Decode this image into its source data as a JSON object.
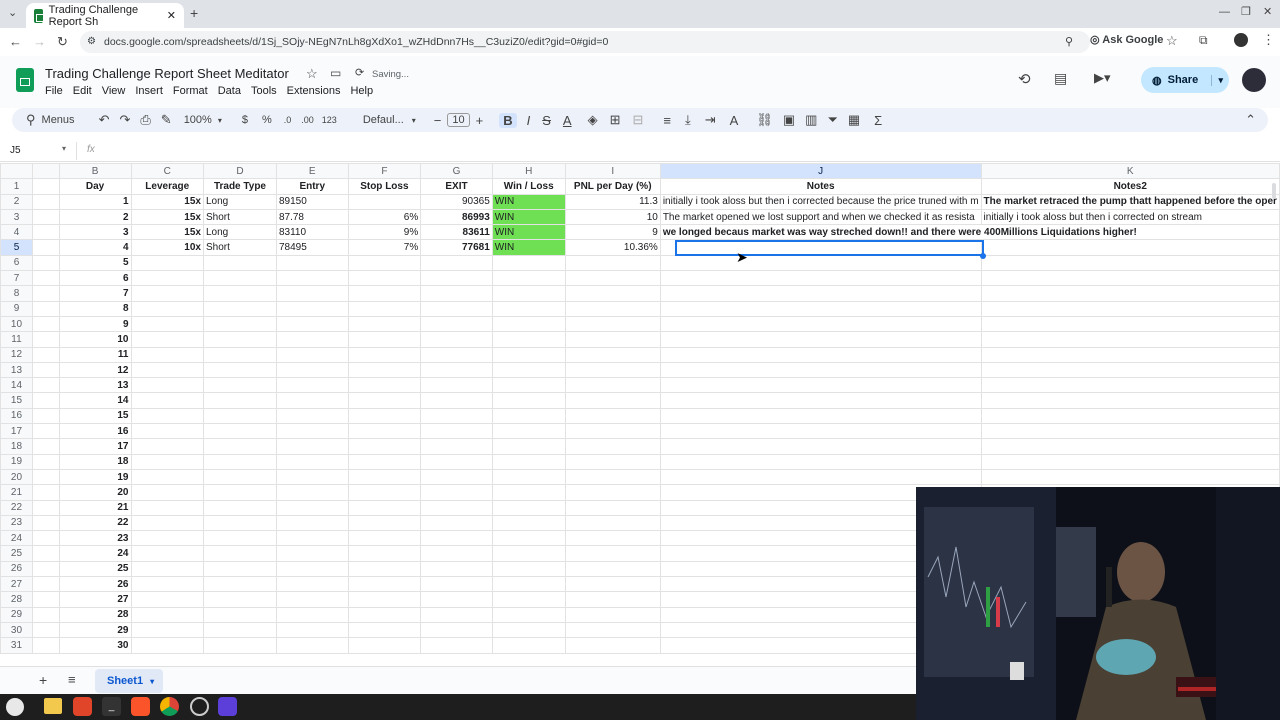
{
  "browser": {
    "tab_title": "Trading Challenge Report Sh",
    "new_tab": "+",
    "url": "docs.google.com/spreadsheets/d/1Sj_SOjy-NEgN7nLh8gXdXo1_wZHdDnn7Hs__C3uziZ0/edit?gid=0#gid=0",
    "ask_google": "Ask Google"
  },
  "doc": {
    "title": "Trading Challenge Report Sheet Meditator",
    "status": "Saving...",
    "menus": [
      "File",
      "Edit",
      "View",
      "Insert",
      "Format",
      "Data",
      "Tools",
      "Extensions",
      "Help"
    ],
    "share": "Share"
  },
  "toolbar": {
    "menus_label": "Menus",
    "zoom": "100%",
    "currency": "$",
    "percent": "%",
    "dec_dec": ".0",
    "dec_inc": ".00",
    "number_format": "123",
    "font": "Defaul...",
    "font_size": "10"
  },
  "formula": {
    "cell_ref": "J5",
    "fx": "fx"
  },
  "columns": [
    "B",
    "C",
    "D",
    "E",
    "F",
    "G",
    "H",
    "I",
    "J",
    "K"
  ],
  "headers": [
    "Day",
    "Leverage",
    "Trade Type",
    "Entry",
    "Stop Loss",
    "EXIT",
    "Win / Loss",
    "PNL per Day (%)",
    "Notes",
    "Notes2"
  ],
  "rows": [
    {
      "n": "2",
      "day": "1",
      "lev": "15x",
      "type": "Long",
      "entry": "89150",
      "sl": "",
      "exit": "90365",
      "wl": "WIN",
      "pnl": "11.3",
      "notes": "initially i took aloss but then i corrected because the price truned with m",
      "notes2": "The market retraced the pump thatt happened before the oper"
    },
    {
      "n": "3",
      "day": "2",
      "lev": "15x",
      "type": "Short",
      "entry": "87.78",
      "sl": "6%",
      "exit": "86993",
      "wl": "WIN",
      "pnl": "10",
      "notes": "The market opened we lost support and when we checked it as resista",
      "notes2": "initially i took aloss but then i corrected on stream"
    },
    {
      "n": "4",
      "day": "3",
      "lev": "15x",
      "type": "Long",
      "entry": "83110",
      "sl": "9%",
      "exit": "83611",
      "wl": "WIN",
      "pnl": "9",
      "notes": "we longed becaus market was way streched down!! and there were 400Millions Liquidations higher!",
      "notes2": ""
    },
    {
      "n": "5",
      "day": "4",
      "lev": "10x",
      "type": "Short",
      "entry": "78495",
      "sl": "7%",
      "exit": "77681",
      "wl": "WIN",
      "pnl": "10.36%",
      "notes": "",
      "notes2": ""
    }
  ],
  "empty_days": [
    "5",
    "6",
    "7",
    "8",
    "9",
    "10",
    "11",
    "12",
    "13",
    "14",
    "15",
    "16",
    "17",
    "18",
    "19",
    "20",
    "21",
    "22",
    "23",
    "24",
    "25",
    "26",
    "27",
    "28",
    "29",
    "30"
  ],
  "sheet_tab": "Sheet1"
}
